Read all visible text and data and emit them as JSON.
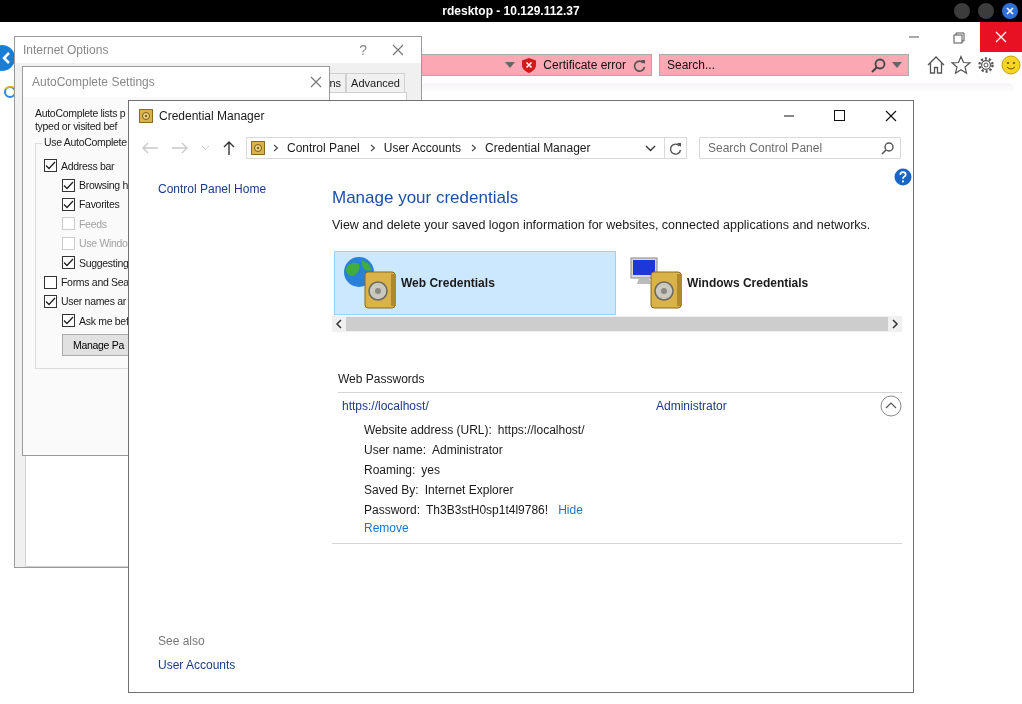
{
  "remote_window": {
    "title": "rdesktop - 10.129.112.37"
  },
  "browser": {
    "address_bar": {
      "status": "Certificate error"
    },
    "search": {
      "placeholder": "Search..."
    }
  },
  "internet_options": {
    "title": "Internet Options",
    "help": "?",
    "tabs": [
      {
        "label": "ns",
        "selected": false
      },
      {
        "label": "Advanced",
        "selected": false
      }
    ]
  },
  "autocomplete": {
    "title": "AutoComplete Settings",
    "description": [
      "AutoComplete lists p",
      "typed or visited bef"
    ],
    "group_label": "Use AutoComplete",
    "options": [
      {
        "label": "Address bar",
        "checked": true,
        "disabled": false,
        "children": [
          {
            "label": "Browsing h",
            "checked": true,
            "disabled": false
          },
          {
            "label": "Favorites",
            "checked": true,
            "disabled": false
          },
          {
            "label": "Feeds",
            "checked": false,
            "disabled": true
          },
          {
            "label": "Use Windo",
            "checked": false,
            "disabled": true
          },
          {
            "label": "Suggesting",
            "checked": true,
            "disabled": false
          }
        ]
      },
      {
        "label": "Forms and Sea",
        "checked": false,
        "disabled": false
      },
      {
        "label": "User names ar",
        "checked": true,
        "disabled": false,
        "children": [
          {
            "label": "Ask me bef",
            "checked": true,
            "disabled": false
          }
        ]
      }
    ],
    "button": "Manage Pa"
  },
  "credential_manager": {
    "title": "Credential Manager",
    "breadcrumbs": [
      "Control Panel",
      "User Accounts",
      "Credential Manager"
    ],
    "search": {
      "placeholder": "Search Control Panel"
    },
    "sidebar": {
      "home_link": "Control Panel Home",
      "see_also": "See also",
      "links": [
        "User Accounts"
      ]
    },
    "heading": "Manage your credentials",
    "description": "View and delete your saved logon information for websites, connected applications and networks.",
    "tiles": [
      {
        "label": "Web Credentials",
        "kind": "web",
        "selected": true
      },
      {
        "label": "Windows Credentials",
        "kind": "windows",
        "selected": false
      }
    ],
    "section_title": "Web Passwords",
    "entries": [
      {
        "address": "https://localhost/",
        "user": "Administrator",
        "expanded": true,
        "details": [
          {
            "label": "Website address (URL):",
            "value": "https://localhost/"
          },
          {
            "label": "User name:",
            "value": "Administrator"
          },
          {
            "label": "Roaming:",
            "value": "yes"
          },
          {
            "label": "Saved By:",
            "value": "Internet Explorer"
          },
          {
            "label": "Password:",
            "value": "Th3B3stH0sp1t4l9786!",
            "link": "Hide"
          }
        ],
        "action": "Remove"
      }
    ]
  }
}
